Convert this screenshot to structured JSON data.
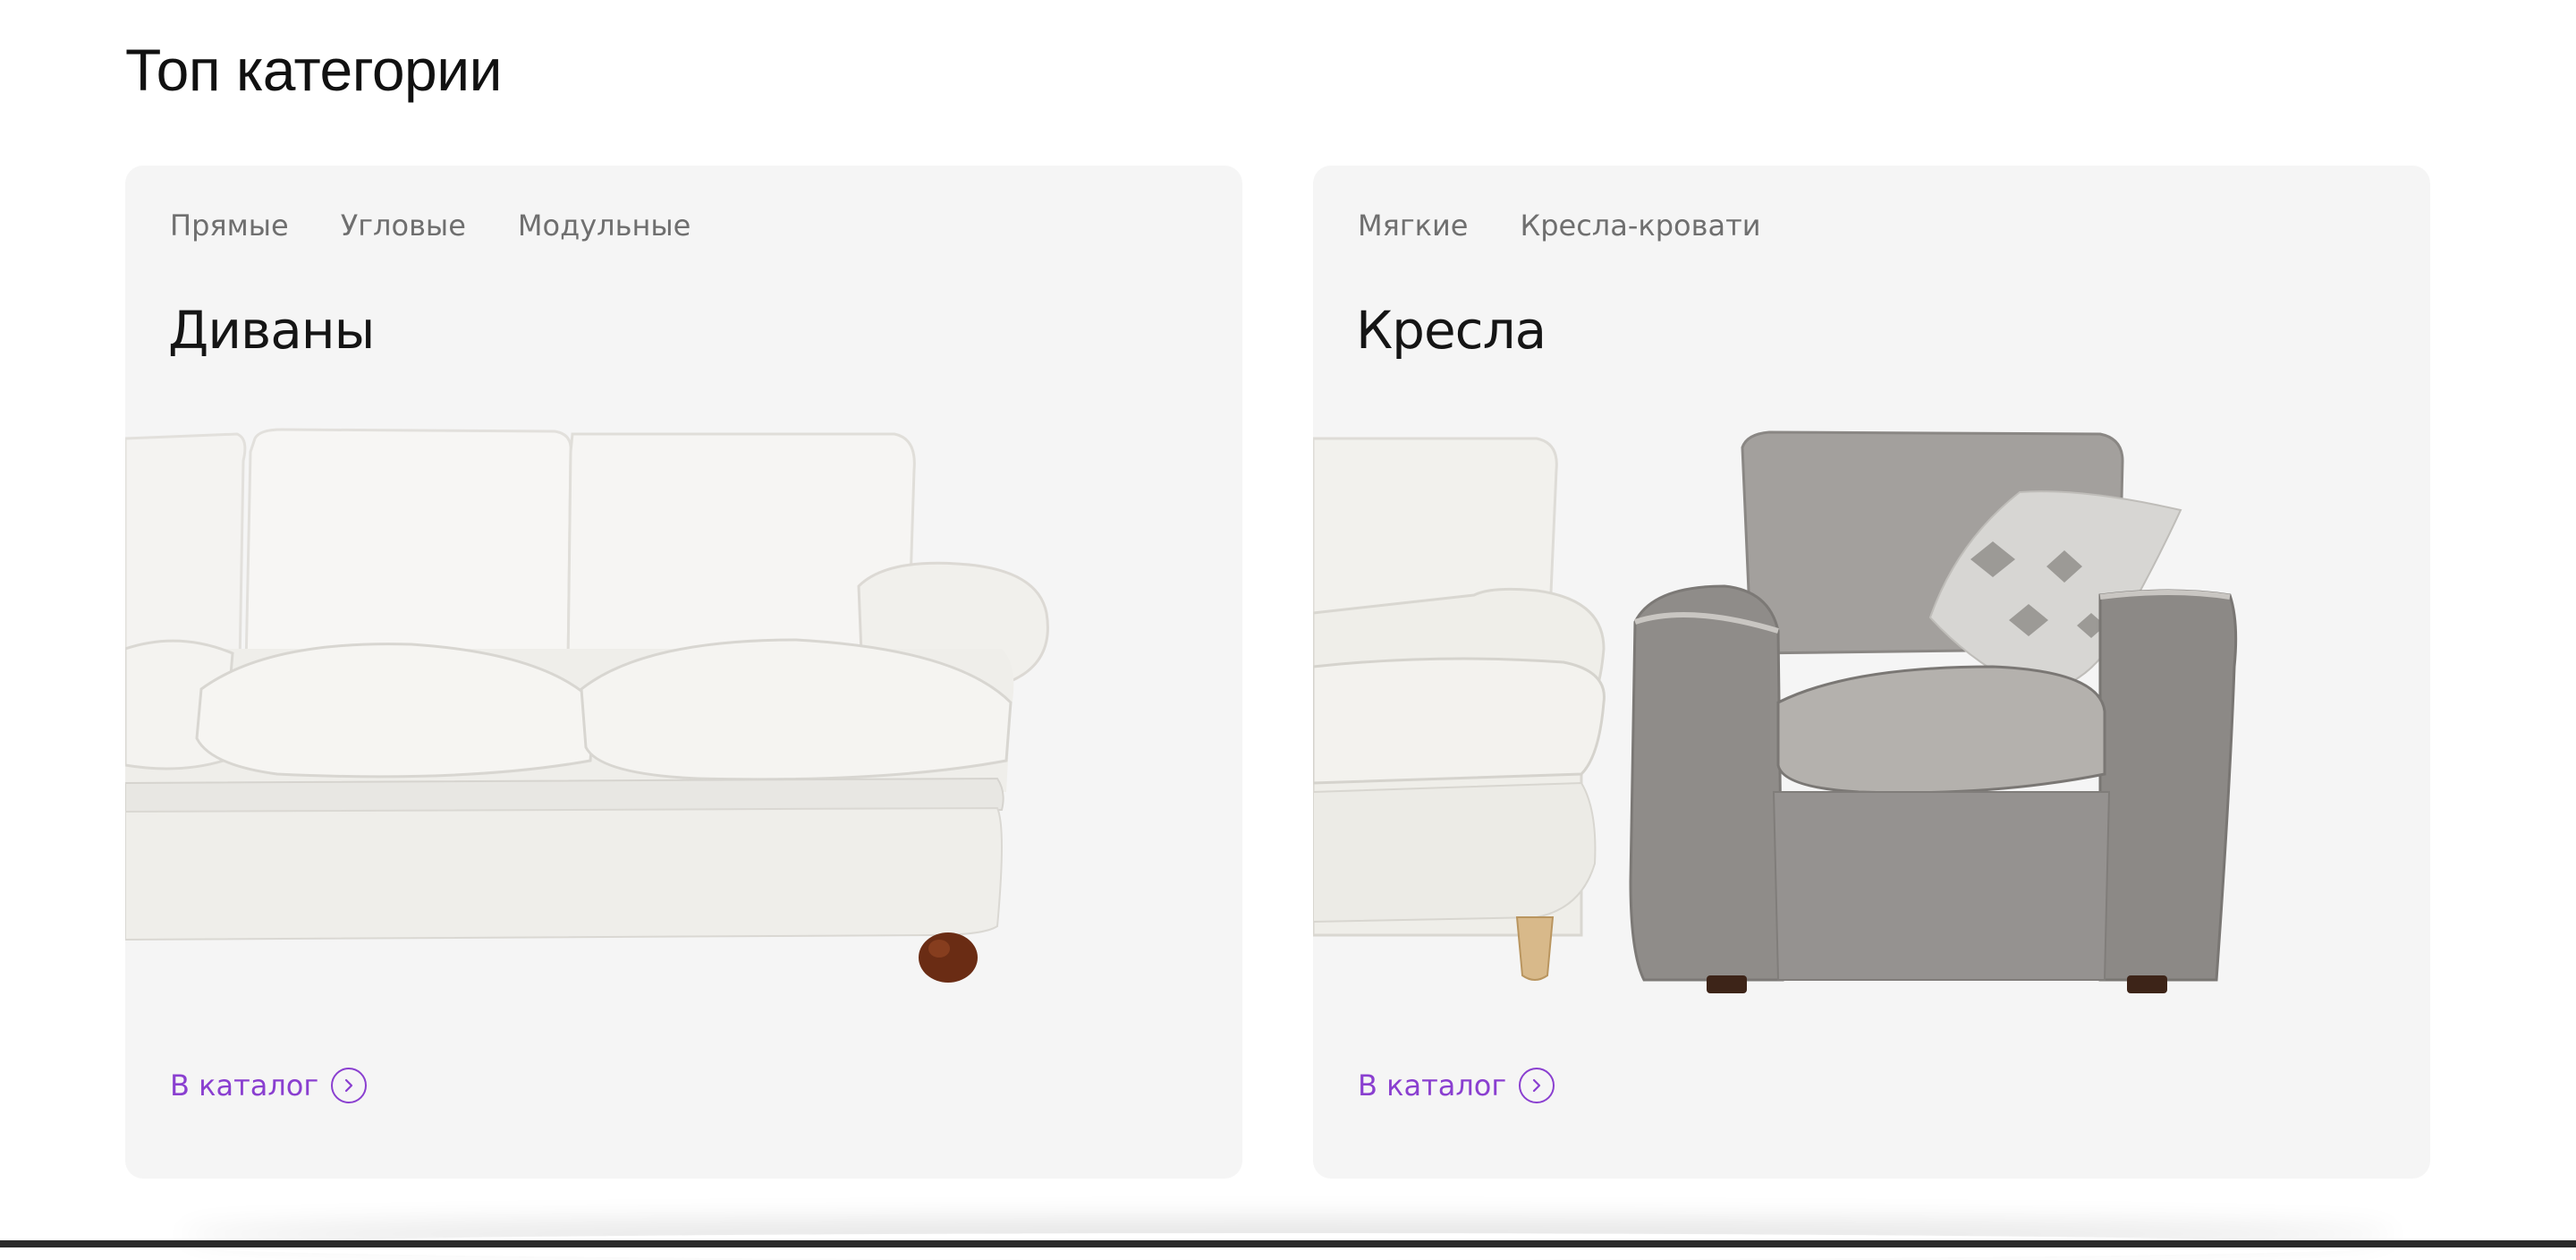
{
  "section": {
    "title": "Топ категории"
  },
  "cards": [
    {
      "title": "Диваны",
      "subcategories": [
        "Прямые",
        "Угловые",
        "Модульные"
      ],
      "link": "В каталог",
      "image": "white-sofa-image"
    },
    {
      "title": "Кресла",
      "subcategories": [
        "Мягкие",
        "Кресла-кровати"
      ],
      "link": "В каталог",
      "image": "armchairs-image"
    }
  ],
  "colors": {
    "accent": "#8a3fd0",
    "card_background": "#f5f5f5",
    "subnav_text": "#6f6f6f",
    "title_text": "#111111"
  },
  "icons": {
    "catalog_arrow": "chevron-right-circle-icon"
  }
}
